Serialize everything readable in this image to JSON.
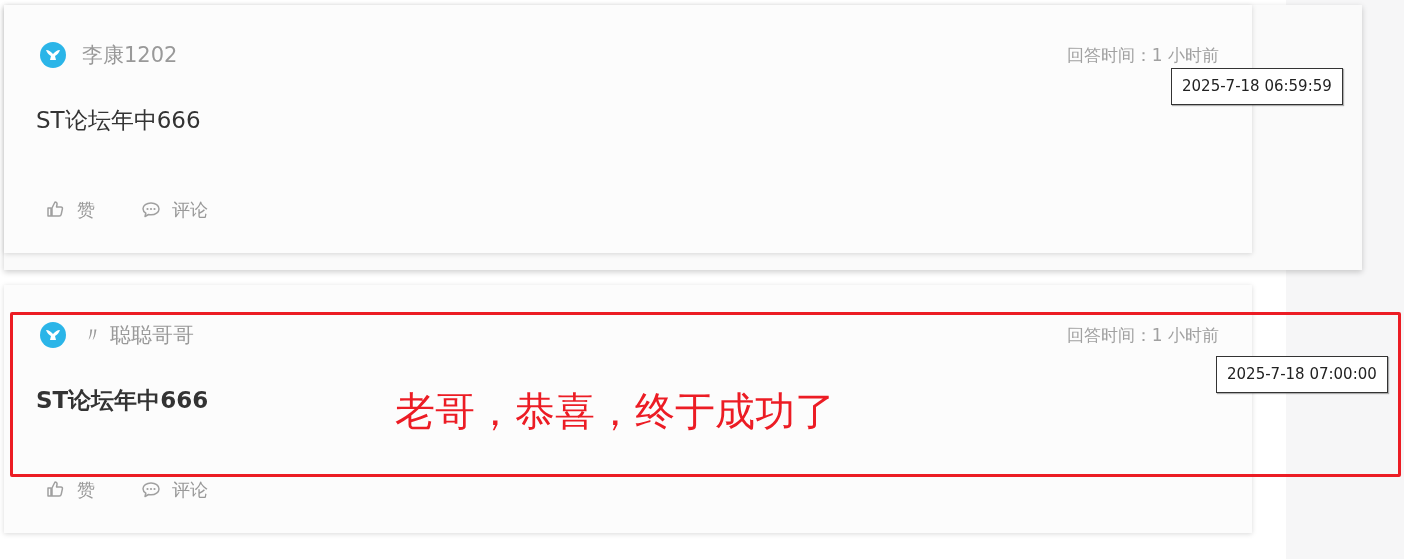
{
  "posts": [
    {
      "author": "李康1202",
      "reply_time": "回答时间：1 小时前",
      "tooltip": "2025-7-18 06:59:59",
      "content": "ST论坛年中666",
      "content_bold": false,
      "actions": [
        {
          "kind": "like",
          "label": "赞"
        },
        {
          "kind": "comment",
          "label": "评论"
        }
      ]
    },
    {
      "author": "〃 聪聪哥哥",
      "reply_time": "回答时间：1 小时前",
      "tooltip": "2025-7-18 07:00:00",
      "content": "ST论坛年中666",
      "content_bold": true,
      "actions": [
        {
          "kind": "like",
          "label": "赞"
        },
        {
          "kind": "comment",
          "label": "评论"
        }
      ]
    }
  ],
  "annotation": {
    "text": "老哥，恭喜，终于成功了"
  }
}
